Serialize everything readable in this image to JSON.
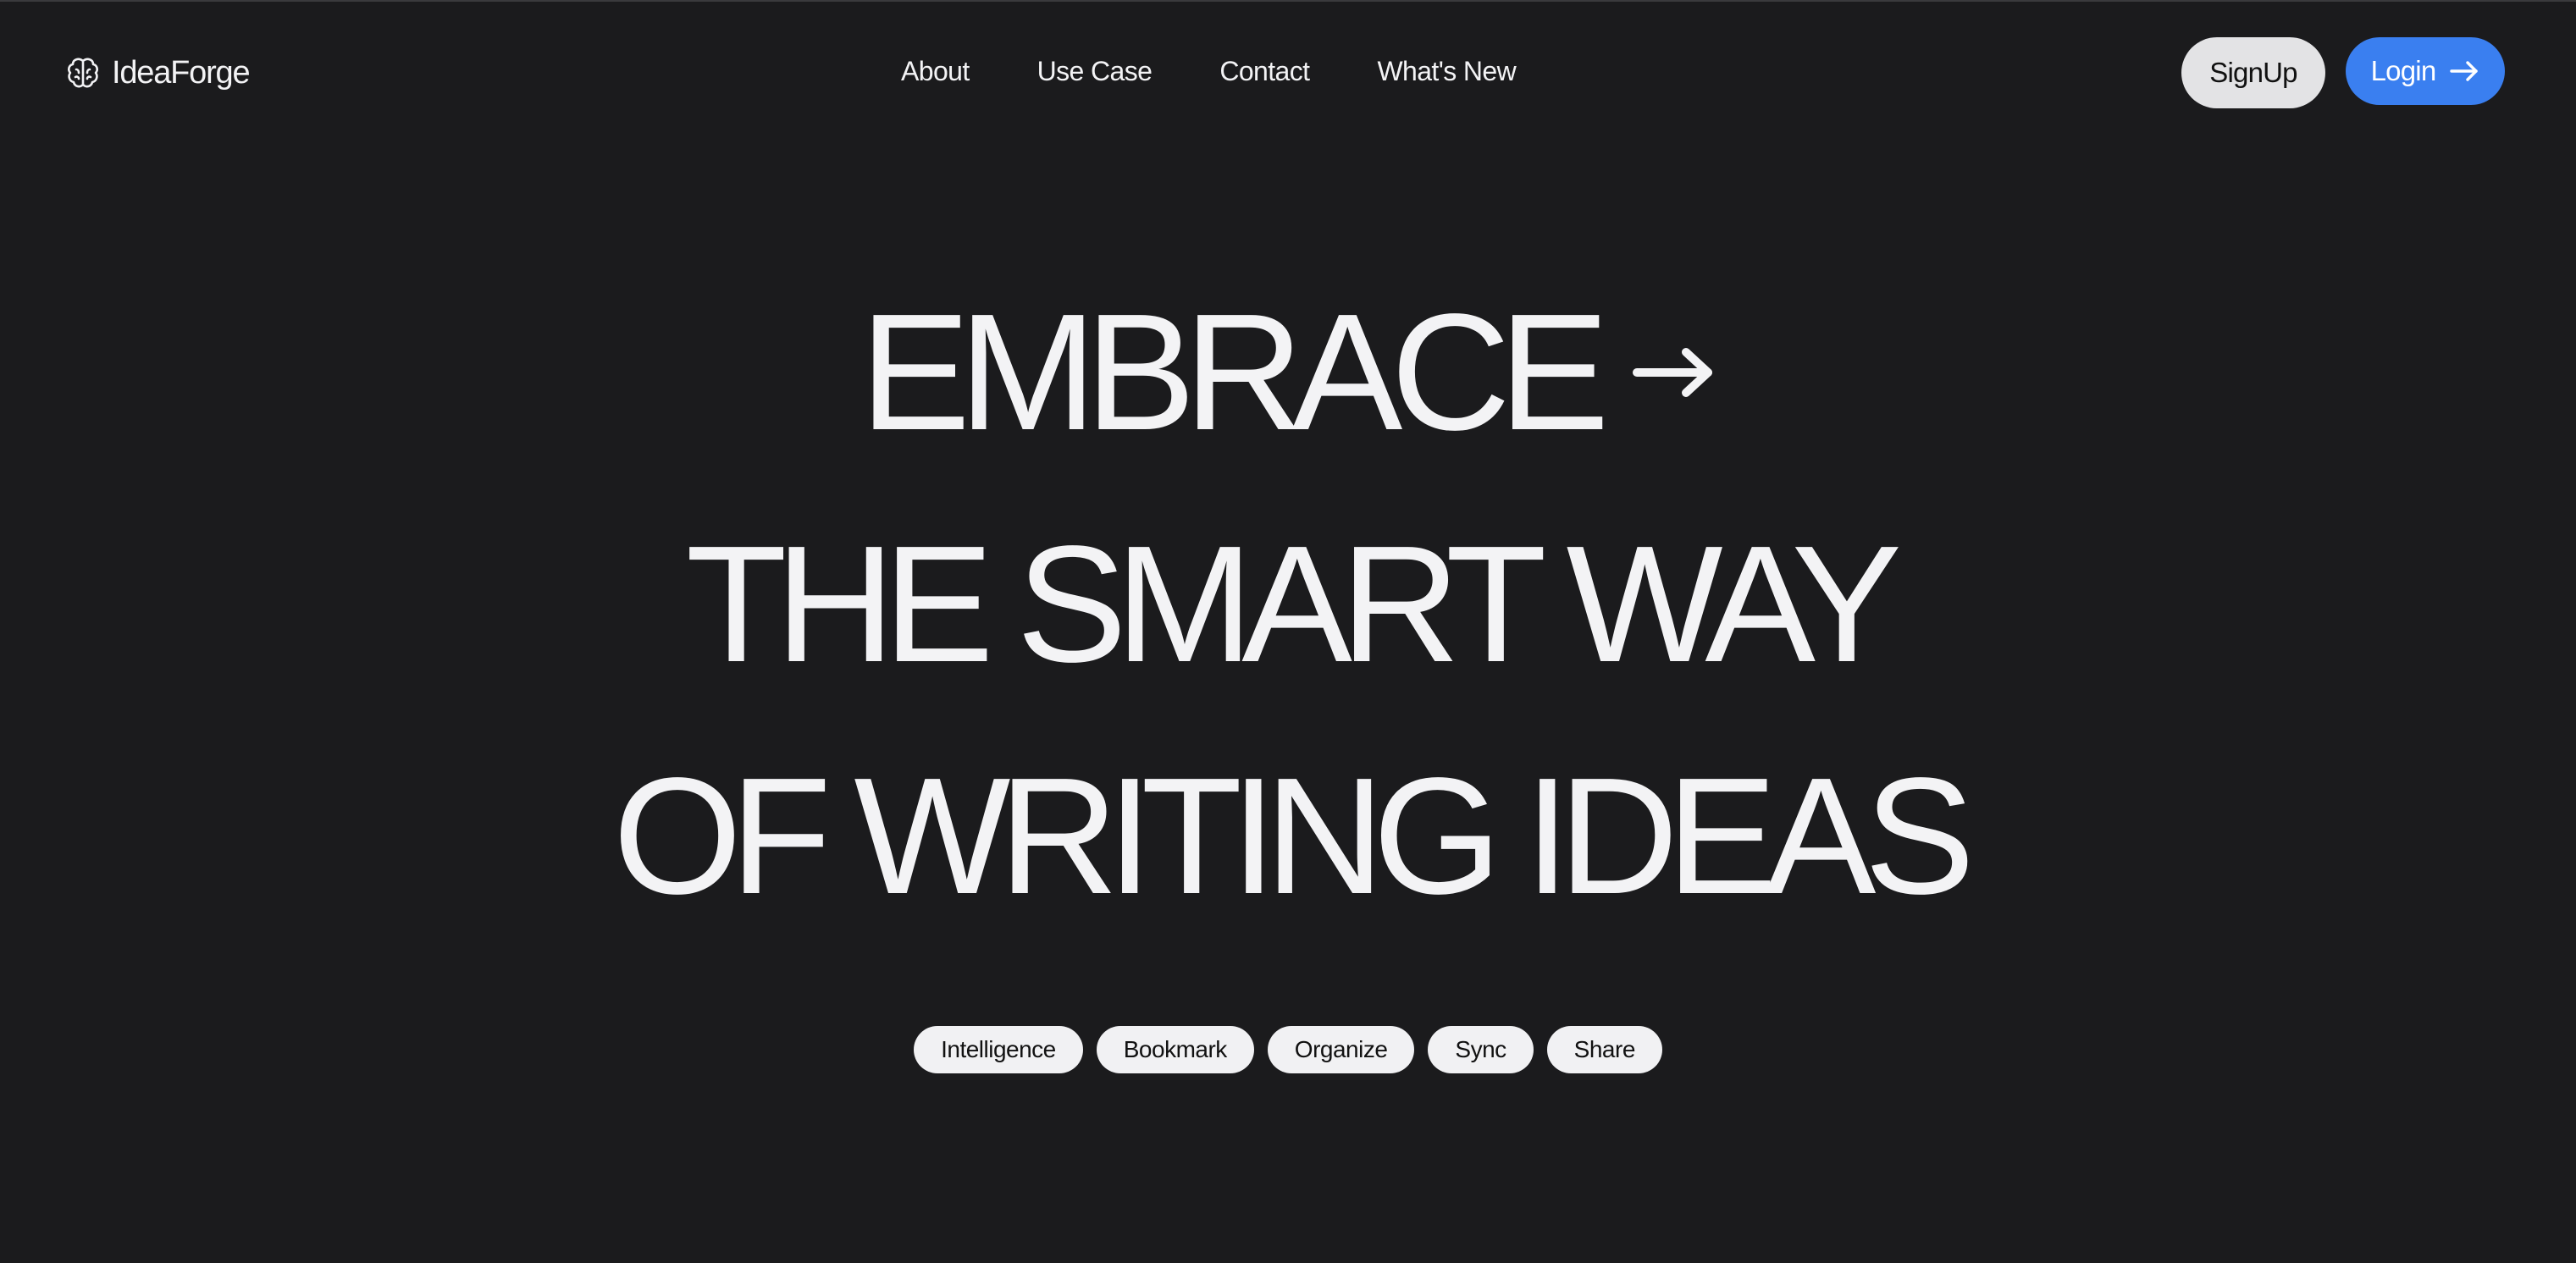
{
  "brand": {
    "name": "IdeaForge",
    "icon": "brain-icon"
  },
  "nav": {
    "links": [
      "About",
      "Use Case",
      "Contact",
      "What's New"
    ]
  },
  "auth": {
    "signup_label": "SignUp",
    "login_label": "Login",
    "login_icon": "arrow-right-icon"
  },
  "hero": {
    "line1": "EMBRACE",
    "line1_icon": "arrow-right-icon",
    "line2": "THE SMART WAY",
    "line3": "OF WRITING IDEAS"
  },
  "tags": [
    "Intelligence",
    "Bookmark",
    "Organize",
    "Sync",
    "Share"
  ],
  "colors": {
    "background": "#1b1b1d",
    "text": "#f3f3f5",
    "login_button": "#3a7ff0",
    "signup_button": "#e3e3e5",
    "tag_background": "#f1f1f3"
  }
}
